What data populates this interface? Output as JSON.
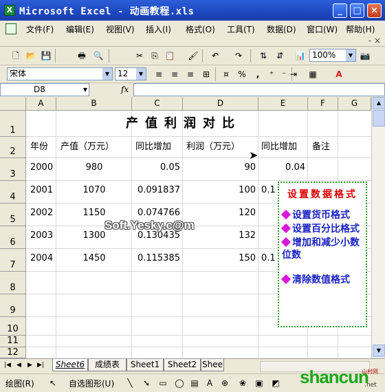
{
  "window": {
    "title": "Microsoft Excel - 动画教程.xls"
  },
  "menu": {
    "items": [
      "文件(F)",
      "编辑(E)",
      "视图(V)",
      "插入(I)",
      "格式(O)",
      "工具(T)",
      "数据(D)",
      "窗口(W)",
      "帮助(H)"
    ],
    "close_glyph": "- ×"
  },
  "toolbar": {
    "zoom": "100%",
    "font_name": "宋体",
    "font_size": "12",
    "percent_glyph": "%",
    "comma_glyph": ","
  },
  "formula_bar": {
    "name_box": "D8",
    "fx": "fx",
    "value": ""
  },
  "columns": [
    "A",
    "B",
    "C",
    "D",
    "E",
    "F",
    "G"
  ],
  "rows": [
    "1",
    "2",
    "3",
    "4",
    "5",
    "6",
    "7",
    "8",
    "9",
    "10",
    "11",
    "12"
  ],
  "sheet": {
    "title": "产值利润对比",
    "headers": [
      "年份",
      "产值（万元）",
      "同比增加",
      "利润（万元）",
      "同比增加",
      "备注"
    ],
    "data": [
      [
        "2000",
        "980",
        "0.05",
        "90",
        "0.04"
      ],
      [
        "2001",
        "1070",
        "0.091837",
        "100",
        "0.1"
      ],
      [
        "2002",
        "1150",
        "0.074766",
        "120",
        ""
      ],
      [
        "2003",
        "1300",
        "0.130435",
        "132",
        ""
      ],
      [
        "2004",
        "1450",
        "0.115385",
        "150",
        "0.1"
      ]
    ]
  },
  "popup": {
    "title": "设置数据格式",
    "items": [
      "设置货币格式",
      "设置百分比格式",
      "增加和减少小数位数",
      "清除数值格式"
    ]
  },
  "watermark": "Soft.Yesky.c@m",
  "sheet_tabs": [
    "Sheet6",
    "成绩表",
    "Sheet1",
    "Sheet2",
    "Shee"
  ],
  "drawing_toolbar": {
    "draw_label": "绘图(R)",
    "autoshapes_label": "自选图形(U)"
  },
  "logo": {
    "brand": "shancun",
    "sub": "山村网",
    "domain": ".net"
  }
}
